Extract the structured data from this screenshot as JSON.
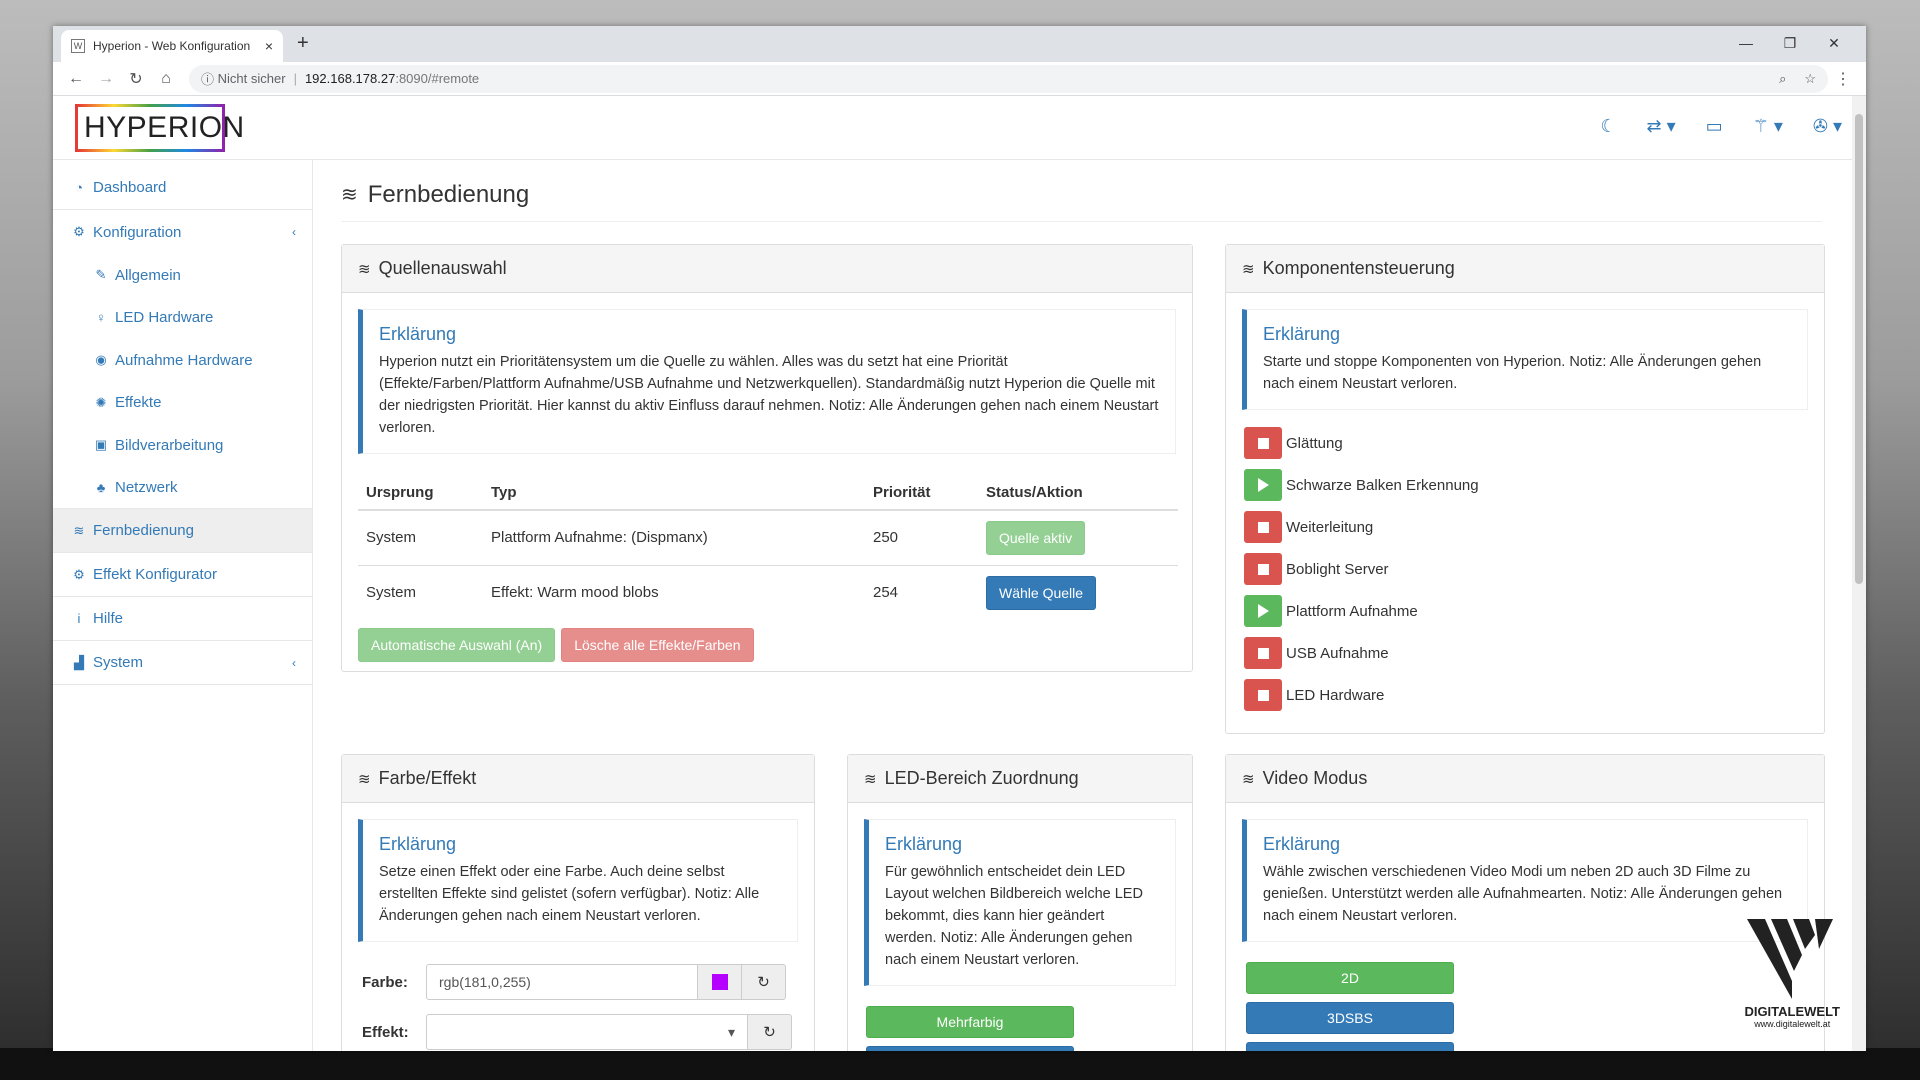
{
  "browser": {
    "tab_title": "Hyperion - Web Konfiguration",
    "tab_favicon": "W",
    "tab_close": "×",
    "new_tab": "+",
    "not_secure": "Nicht sicher",
    "url_host": "192.168.178.27",
    "url_rest": ":8090/#remote",
    "win_min": "—",
    "win_restore": "❐",
    "win_close": "✕"
  },
  "app": {
    "logo": "HYPERION",
    "top_icons": [
      "moon-icon",
      "transfer-icon",
      "monitor-icon",
      "magic-icon",
      "wrench-icon"
    ]
  },
  "sidebar": {
    "items": [
      {
        "label": "Dashboard",
        "icon": "⚙",
        "sub": false
      },
      {
        "label": "Konfiguration",
        "icon": "⚙",
        "sub": false,
        "chev": "‹"
      },
      {
        "label": "Allgemein",
        "icon": "✎",
        "sub": true
      },
      {
        "label": "LED Hardware",
        "icon": "♀",
        "sub": true
      },
      {
        "label": "Aufnahme Hardware",
        "icon": "◉",
        "sub": true
      },
      {
        "label": "Effekte",
        "icon": "✺",
        "sub": true
      },
      {
        "label": "Bildverarbeitung",
        "icon": "▣",
        "sub": true
      },
      {
        "label": "Netzwerk",
        "icon": "♣",
        "sub": true
      },
      {
        "label": "Fernbedienung",
        "icon": "≋",
        "sub": false,
        "active": true
      },
      {
        "label": "Effekt Konfigurator",
        "icon": "⚙",
        "sub": false
      },
      {
        "label": "Hilfe",
        "icon": "i",
        "sub": false
      },
      {
        "label": "System",
        "icon": "▟",
        "sub": false,
        "chev": "‹"
      }
    ]
  },
  "page": {
    "title": "Fernbedienung"
  },
  "sources": {
    "title": "Quellenauswahl",
    "info_title": "Erklärung",
    "info_text": "Hyperion nutzt ein Prioritätensystem um die Quelle zu wählen. Alles was du setzt hat eine Priorität (Effekte/Farben/Plattform Aufnahme/USB Aufnahme und Netzwerkquellen). Standardmäßig nutzt Hyperion die Quelle mit der niedrigsten Priorität. Hier kannst du aktiv Einfluss darauf nehmen. Notiz: Alle Änderungen gehen nach einem Neustart verloren.",
    "headers": [
      "Ursprung",
      "Typ",
      "Priorität",
      "Status/Aktion"
    ],
    "rows": [
      {
        "origin": "System",
        "type": "Plattform Aufnahme: (Dispmanx)",
        "prio": "250",
        "action": "Quelle aktiv"
      },
      {
        "origin": "System",
        "type": "Effekt: Warm mood blobs",
        "prio": "254",
        "action": "Wähle Quelle"
      }
    ],
    "btn_auto": "Automatische Auswahl (An)",
    "btn_clear": "Lösche alle Effekte/Farben"
  },
  "components": {
    "title": "Komponentensteuerung",
    "info_title": "Erklärung",
    "info_text": "Starte und stoppe Komponenten von Hyperion. Notiz: Alle Änderungen gehen nach einem Neustart verloren.",
    "items": [
      {
        "label": "Glättung",
        "state": "stop"
      },
      {
        "label": "Schwarze Balken Erkennung",
        "state": "play"
      },
      {
        "label": "Weiterleitung",
        "state": "stop"
      },
      {
        "label": "Boblight Server",
        "state": "stop"
      },
      {
        "label": "Plattform Aufnahme",
        "state": "play"
      },
      {
        "label": "USB Aufnahme",
        "state": "stop"
      },
      {
        "label": "LED Hardware",
        "state": "stop"
      }
    ]
  },
  "color": {
    "title": "Farbe/Effekt",
    "info_title": "Erklärung",
    "info_text": "Setze einen Effekt oder eine Farbe. Auch deine selbst erstellten Effekte sind gelistet (sofern verfügbar). Notiz: Alle Änderungen gehen nach einem Neustart verloren.",
    "color_label": "Farbe:",
    "color_value": "rgb(181,0,255)",
    "swatch": "#b500ff",
    "effect_label": "Effekt:",
    "effect_value": "",
    "reset": "↻",
    "dropdown": "▾"
  },
  "led": {
    "title": "LED-Bereich Zuordnung",
    "info_title": "Erklärung",
    "info_text": "Für gewöhnlich entscheidet dein LED Layout welchen Bildbereich welche LED bekommt, dies kann hier geändert werden. Notiz: Alle Änderungen gehen nach einem Neustart verloren.",
    "btn_multi": "Mehrfarbig"
  },
  "video": {
    "title": "Video Modus",
    "info_title": "Erklärung",
    "info_text": "Wähle zwischen verschiedenen Video Modi um neben 2D auch 3D Filme zu genießen. Unterstützt werden alle Aufnahmearten. Notiz: Alle Änderungen gehen nach einem Neustart verloren.",
    "btn_2d": "2D",
    "btn_3dsbs": "3DSBS"
  },
  "watermark": {
    "name": "DIGITALEWELT",
    "url": "www.digitalewelt.at"
  }
}
